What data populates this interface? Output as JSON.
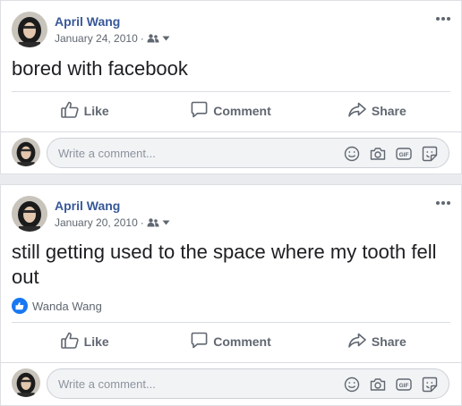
{
  "posts": [
    {
      "author": "April Wang",
      "date": "January 24, 2010",
      "meta_separator": "·",
      "text": "bored with facebook",
      "reactions": null,
      "actions": {
        "like": "Like",
        "comment": "Comment",
        "share": "Share"
      },
      "comment_placeholder": "Write a comment..."
    },
    {
      "author": "April Wang",
      "date": "January 20, 2010",
      "meta_separator": "·",
      "text": "still getting used to the space where my tooth fell out",
      "reactions": {
        "names": "Wanda Wang"
      },
      "actions": {
        "like": "Like",
        "comment": "Comment",
        "share": "Share"
      },
      "comment_placeholder": "Write a comment..."
    }
  ],
  "colors": {
    "link": "#385898",
    "accent": "#1877f2",
    "secondary": "#606770"
  },
  "icons": [
    "friends-audience-icon",
    "caret-down-icon",
    "more-options-icon",
    "like-icon",
    "comment-icon",
    "share-icon",
    "emoji-icon",
    "camera-icon",
    "gif-icon",
    "sticker-icon"
  ]
}
